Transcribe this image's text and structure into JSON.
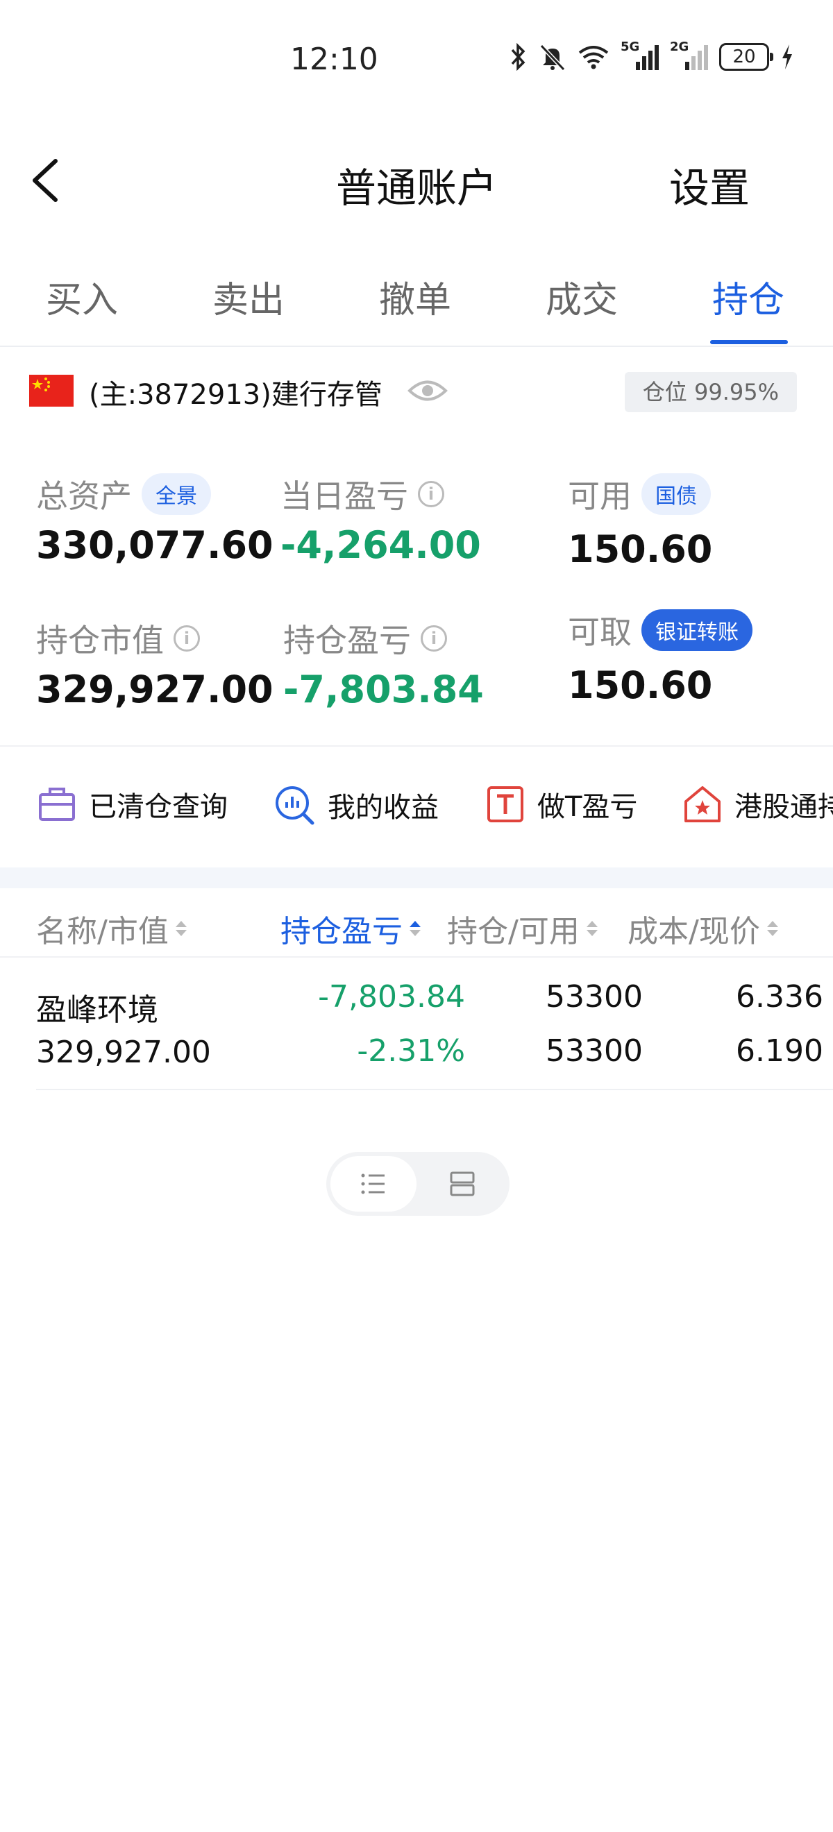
{
  "status_bar": {
    "time": "12:10",
    "battery": "20",
    "sig1_label": "5G",
    "sig2_label": "2G"
  },
  "nav": {
    "title": "普通账户",
    "settings": "设置"
  },
  "tabs": [
    {
      "label": "买入"
    },
    {
      "label": "卖出"
    },
    {
      "label": "撤单"
    },
    {
      "label": "成交"
    },
    {
      "label": "持仓"
    }
  ],
  "active_tab": "持仓",
  "account": {
    "text": "(主:3872913)建行存管",
    "position_badge": "仓位 99.95%"
  },
  "summary": {
    "total_assets": {
      "label": "总资产",
      "chip": "全景",
      "value": "330,077.60"
    },
    "daily_pnl": {
      "label": "当日盈亏",
      "value": "-4,264.00"
    },
    "available": {
      "label": "可用",
      "chip": "国债",
      "value": "150.60"
    },
    "market_value": {
      "label": "持仓市值",
      "value": "329,927.00"
    },
    "position_pnl": {
      "label": "持仓盈亏",
      "value": "-7,803.84"
    },
    "withdrawable": {
      "label": "可取",
      "chip": "银证转账",
      "value": "150.60"
    }
  },
  "shortcuts": [
    {
      "label": "已清仓查询",
      "icon": "briefcase-icon"
    },
    {
      "label": "我的收益",
      "icon": "chart-magnifier-icon"
    },
    {
      "label": "做T盈亏",
      "icon": "t-box-icon"
    },
    {
      "label": "港股通持",
      "icon": "hk-flower-icon"
    }
  ],
  "table": {
    "headers": [
      "名称/市值",
      "持仓盈亏",
      "持仓/可用",
      "成本/现价"
    ],
    "rows": [
      {
        "name": "盈峰环境",
        "market_value": "329,927.00",
        "pnl": "-7,803.84",
        "pnl_pct": "-2.31%",
        "holding": "53300",
        "available": "53300",
        "cost": "6.336",
        "price": "6.190"
      }
    ]
  },
  "colors": {
    "accent": "#1c5fe0",
    "loss_green": "#16a06a",
    "muted": "#888888"
  }
}
